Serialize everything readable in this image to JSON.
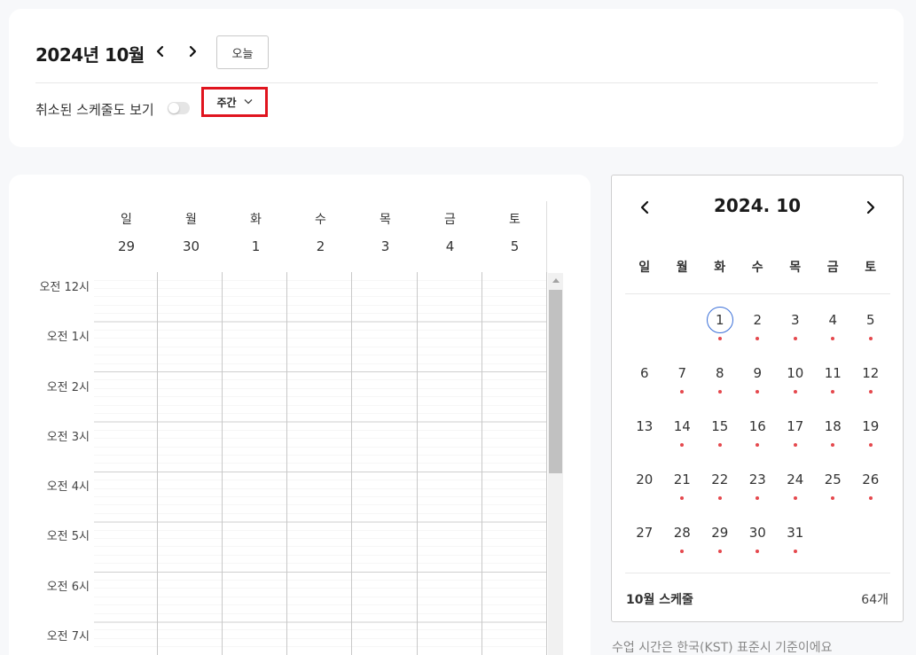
{
  "header": {
    "title": "2024년 10월",
    "today_label": "오늘",
    "show_cancelled_label": "취소된 스케줄도 보기",
    "show_cancelled_on": false,
    "view_mode": "주간"
  },
  "week": {
    "days": [
      {
        "name": "일",
        "date": "29"
      },
      {
        "name": "월",
        "date": "30"
      },
      {
        "name": "화",
        "date": "1"
      },
      {
        "name": "수",
        "date": "2"
      },
      {
        "name": "목",
        "date": "3"
      },
      {
        "name": "금",
        "date": "4"
      },
      {
        "name": "토",
        "date": "5"
      }
    ],
    "hours": [
      "오전 12시",
      "오전 1시",
      "오전 2시",
      "오전 3시",
      "오전 4시",
      "오전 5시",
      "오전 6시",
      "오전 7시"
    ]
  },
  "mini_calendar": {
    "title": "2024. 10",
    "weekdays": [
      "일",
      "월",
      "화",
      "수",
      "목",
      "금",
      "토"
    ],
    "today": "1",
    "dot_color": "#e5484d",
    "today_ring_color": "#3a6fd8",
    "weeks": [
      [
        "",
        "",
        "1",
        "2",
        "3",
        "4",
        "5"
      ],
      [
        "6",
        "7",
        "8",
        "9",
        "10",
        "11",
        "12"
      ],
      [
        "13",
        "14",
        "15",
        "16",
        "17",
        "18",
        "19"
      ],
      [
        "20",
        "21",
        "22",
        "23",
        "24",
        "25",
        "26"
      ],
      [
        "27",
        "28",
        "29",
        "30",
        "31",
        "",
        ""
      ]
    ],
    "has_schedule": [
      [
        false,
        false,
        true,
        true,
        true,
        true,
        true
      ],
      [
        false,
        true,
        true,
        true,
        true,
        true,
        true
      ],
      [
        false,
        true,
        true,
        true,
        true,
        true,
        true
      ],
      [
        false,
        true,
        true,
        true,
        true,
        true,
        true
      ],
      [
        false,
        true,
        true,
        true,
        true,
        false,
        false
      ]
    ],
    "footer_label": "10월 스케줄",
    "footer_count": "64개"
  },
  "timezone_note": "수업 시간은 한국(KST) 표준시 기준이에요"
}
